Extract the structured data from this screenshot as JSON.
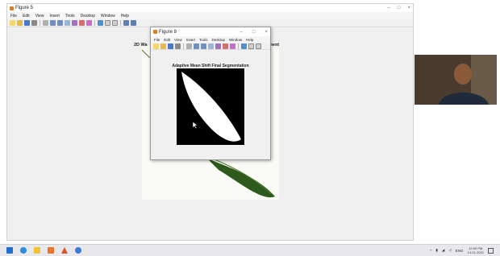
{
  "background_window": {
    "title": "Figure 5",
    "menu": [
      "File",
      "Edit",
      "View",
      "Insert",
      "Tools",
      "Desktop",
      "Window",
      "Help"
    ],
    "plot_title_left": "2D Wa",
    "plot_title_right": "ment",
    "controls": [
      "–",
      "□",
      "×"
    ]
  },
  "figure8": {
    "title": "Figure 8",
    "menu": [
      "File",
      "Edit",
      "View",
      "Insert",
      "Tools",
      "Desktop",
      "Window",
      "Help"
    ],
    "controls": [
      "–",
      "□",
      "×"
    ],
    "plot_title": "Adaptive Mean Shift Final Segmentation"
  },
  "taskbar": {
    "clock_time": "12:09 PM",
    "clock_date": "14-01-2021",
    "tray_lang": "ENG"
  },
  "colors": {
    "leaf": "#2f5a1e",
    "taskbar": "#e8e8ec",
    "matlab_orange": "#d9822b"
  }
}
